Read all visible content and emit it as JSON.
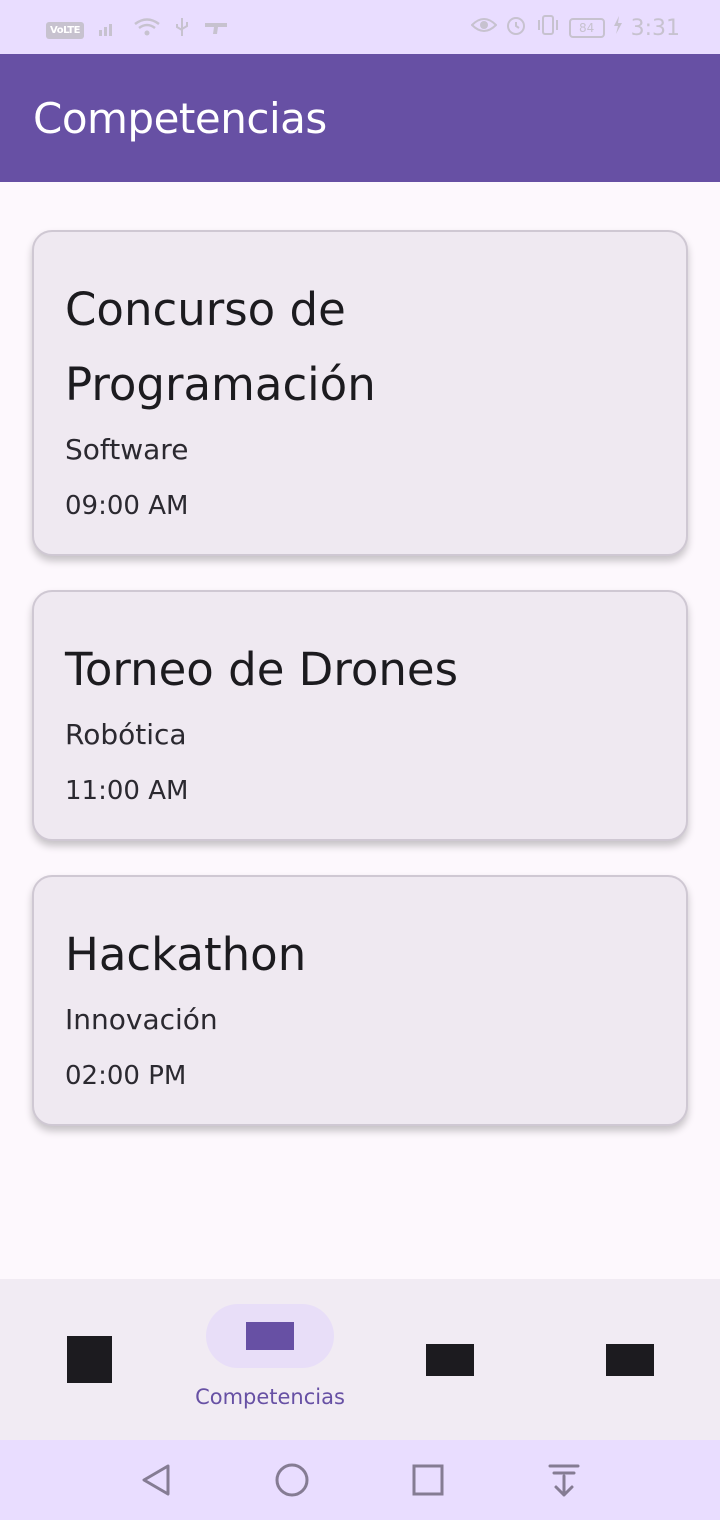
{
  "status_bar": {
    "volte_label": "VoLTE",
    "battery_level": "84",
    "time": "3:31"
  },
  "app_bar": {
    "title": "Competencias"
  },
  "competitions": [
    {
      "title": "Concurso de Programación",
      "category": "Software",
      "time": "09:00 AM"
    },
    {
      "title": "Torneo de Drones",
      "category": "Robótica",
      "time": "11:00 AM"
    },
    {
      "title": "Hackathon",
      "category": "Innovación",
      "time": "02:00 PM"
    }
  ],
  "bottom_nav": {
    "selected_label": "Competencias",
    "active_color": "#6750a4",
    "pill_color": "#e8def8"
  },
  "colors": {
    "primary": "#6750a4",
    "status_bar": "#e9ddff",
    "card_background": "#efe9f1"
  }
}
